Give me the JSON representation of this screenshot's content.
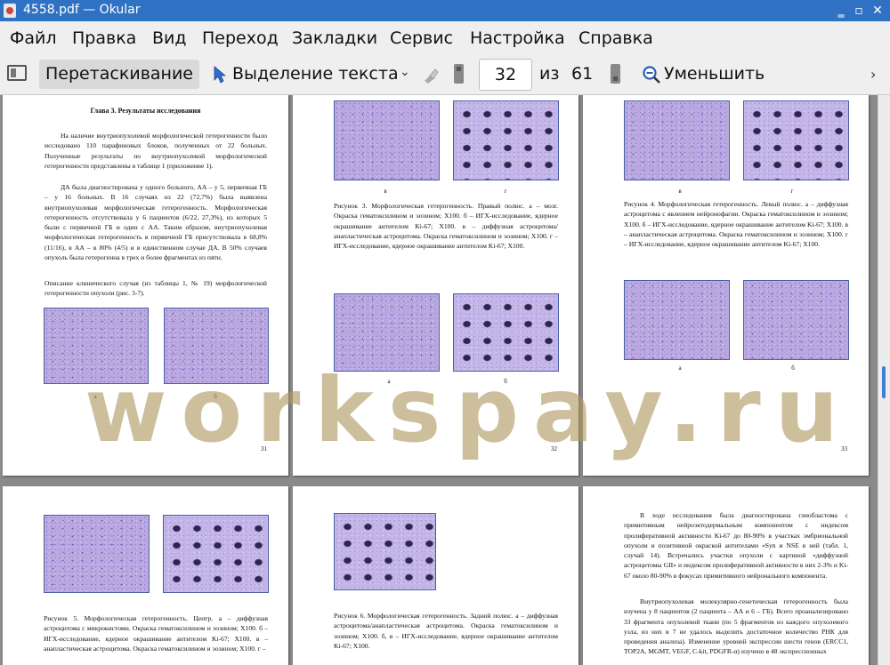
{
  "window": {
    "title": "4558.pdf  — Okular"
  },
  "menu": [
    "Файл",
    "Правка",
    "Вид",
    "Переход",
    "Закладки",
    "Сервис",
    "Настройка",
    "Справка"
  ],
  "toolbar": {
    "drag_label": "Перетаскивание",
    "select_label": "Выделение текста",
    "page_current": "32",
    "page_of": "из",
    "page_total": "61",
    "zoom_out_label": "Уменьшить"
  },
  "watermark": "workspay.ru",
  "pages": {
    "p31": {
      "heading": "Глава 3. Результаты исследования",
      "para1": "На наличие внутриопухолевой морфологической гетерогенности было исследовано 110 парафиновых блоков, полученных от 22 больных. Полученные результаты по внутриопухолевой морфологической гетерогенности представлены в таблице 1 (приложение 1).",
      "para2": "ДА была диагностирована у одного больного, АА – у 5, первичная ГБ – у 16 больных. В 16 случаях из 22 (72,7%) была выявлена внутриопухолевая морфологическая гетерогенность. Морфологическая гетерогенность отсутствовала у 6 пациентов (6/22, 27,3%), из которых 5 были с первичной ГБ и один с АА. Таким образом, внутриопухолевая морфологическая гетерогенность в первичной ГБ присутствовала в 68,8% (11/16), в АА – в 80% (4/5) и в единственном случае ДА. В 50% случаев опухоль была гетерогенна в трех и более фрагментах из пяти.",
      "para3": "Описание клинического случая (из таблицы 1, № 19) морфологической гетерогенности опухоли (рис. 3-7).",
      "cap_a": "а",
      "cap_b": "б",
      "num": "31"
    },
    "p32": {
      "cap_v": "в",
      "cap_g": "г",
      "caption": "Рисунок 3. Морфологическая гетерогенность. Правый полюс. а – мозг. Окраска гематоксилином и эозином; X100. б – ИГХ-исследование, ядерное окрашивание антителом Ki-67; X100. в – диффузная астроцитома/анапластическая астроцитома. Окраска гематоксилином и эозином; X100. г – ИГХ-исследование, ядерное окрашивание антителом Ki-67; X100.",
      "cap_a": "а",
      "cap_b": "б",
      "num": "32"
    },
    "p33": {
      "cap_v": "в",
      "cap_g": "г",
      "caption": "Рисунок 4. Морфологическая гетерогенность. Левый полюс. а – диффузная астроцитома с явлением нейронофагии. Окраска гематоксилином и эозином; X100. б – ИГХ-исследование, ядерное окрашивание антителом Ki-67; X100. в – анапластическая астроцитома. Окраска гематоксилином и эозином; X100. г – ИГХ-исследование, ядерное окрашивание антителом Ki-67; X100.",
      "cap_a": "а",
      "cap_b": "б",
      "num": "33"
    },
    "p34": {
      "caption": "Рисунок 5. Морфологическая гетерогенность. Центр. а – диффузная астроцитома с микрокистоми. Окраска гематоксилином и эозином; X100. б – ИГХ-исследование, ядерное окрашивание антителом Ki-67; X100. в – анапластическая астроцитома. Окраска гематоксилином и эозином; X100. г –"
    },
    "p35": {
      "caption": "Рисунок 6. Морфологическая гетерогенность. Задний полюс. а – диффузная астроцитома/анапластическая астроцитома. Окраска гематоксилином и эозином; X100. б, в – ИГХ-исследование, ядерное окрашивание антителом Ki-67; X100."
    },
    "p36": {
      "para1": "В ходе исследования была диагностирована глиобластома с примитивным нейроэктодермальным компонентом с индексом пролиферативной активности Ki-67 до 80-90% в участках эмбриональной опухоли и позитивной окраской антителами «Syn и NSE в ней (табл. 1, случай 14). Встречались участки опухоли с картиной «диффузной астроцитомы GII» и индексом пролиферативной активности в них 2-3% и Ki-67 около 80-90% в фокусах примитивного нейронального компонента.",
      "para2": "Внутриопухолевая молекулярно-генетическая гетерогенность была изучена у 8 пациентов (2 пациента – АА и 6 – ГБ). Всего проанализировано 33 фрагмента опухолевой ткани (по 5 фрагментов из каждого опухолевого узла, из них в 7 не удалось выделить достаточное количество РНК для проведения анализа). Изменение уровней экспрессии шести генов (ERCC1, TOP2A, MGMT, VEGF, C-kit, PDGFR-α) изучено в 48 экспрессионных"
    }
  }
}
